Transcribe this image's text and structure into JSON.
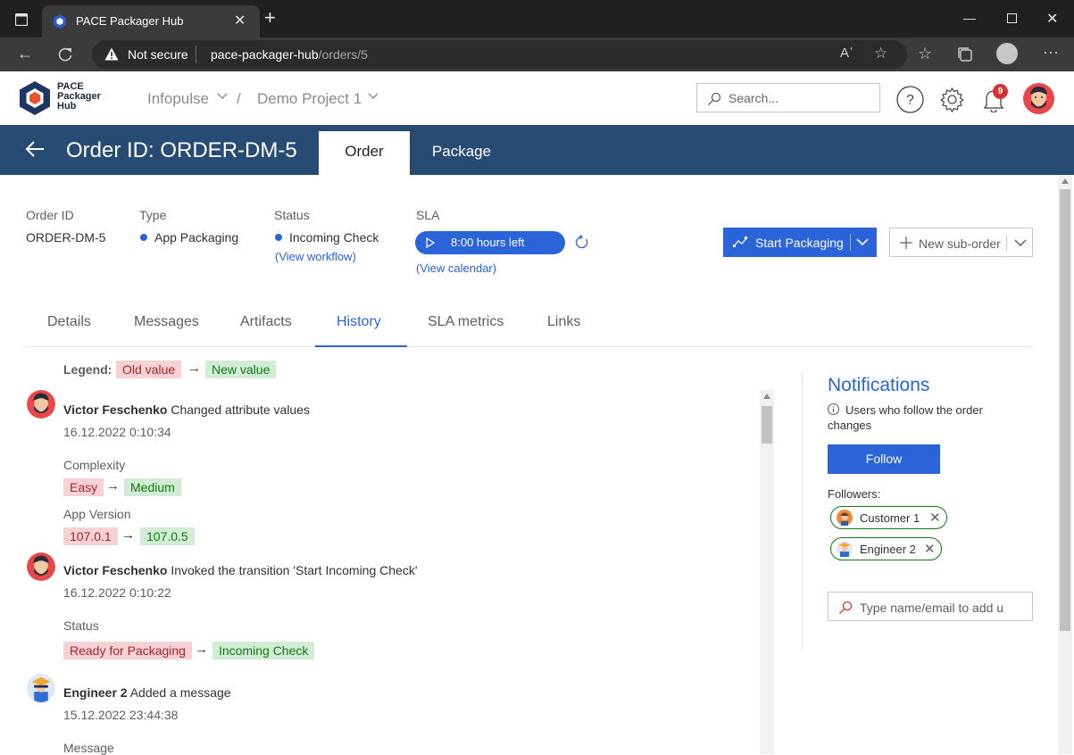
{
  "browser": {
    "tab_title": "PACE Packager Hub",
    "security_label": "Not secure",
    "url_host": "pace-packager-hub",
    "url_path": "/orders/5"
  },
  "header": {
    "logo_lines": [
      "PACE",
      "Packager",
      "Hub"
    ],
    "breadcrumb_org": "Infopulse",
    "breadcrumb_sep": "/",
    "breadcrumb_project": "Demo Project 1",
    "search_placeholder": "Search...",
    "notification_count": "9"
  },
  "order_bar": {
    "title": "Order ID: ORDER-DM-5",
    "tabs": [
      "Order",
      "Package"
    ],
    "active_tab": "Order"
  },
  "info": {
    "order_id_label": "Order ID",
    "order_id_value": "ORDER-DM-5",
    "type_label": "Type",
    "type_value": "App Packaging",
    "status_label": "Status",
    "status_value": "Incoming Check",
    "view_workflow": "(View workflow)",
    "sla_label": "SLA",
    "sla_value": "8:00 hours left",
    "view_calendar": "(View calendar)",
    "start_packaging": "Start Packaging",
    "new_suborder": "New sub-order"
  },
  "subtabs": [
    "Details",
    "Messages",
    "Artifacts",
    "History",
    "SLA metrics",
    "Links"
  ],
  "active_subtab": "History",
  "legend": {
    "label": "Legend:",
    "old": "Old value",
    "new": "New value"
  },
  "history": [
    {
      "user": "Victor Feschenko",
      "action": "Changed attribute values",
      "date": "16.12.2022 0:10:34",
      "changes": [
        {
          "field": "Complexity",
          "old": "Easy",
          "new": "Medium"
        },
        {
          "field": "App Version",
          "old": "107.0.1",
          "new": "107.0.5"
        }
      ]
    },
    {
      "user": "Victor Feschenko",
      "action": "Invoked the transition 'Start Incoming Check'",
      "date": "16.12.2022 0:10:22",
      "changes": [
        {
          "field": "Status",
          "old": "Ready for Packaging",
          "new": "Incoming Check"
        }
      ]
    },
    {
      "user": "Engineer 2",
      "action": "Added a message",
      "date": "15.12.2022 23:44:38",
      "changes": [
        {
          "field": "Message"
        }
      ]
    }
  ],
  "notifications": {
    "title": "Notifications",
    "description": "Users who follow the order changes",
    "follow_button": "Follow",
    "followers_label": "Followers:",
    "followers": [
      "Customer 1",
      "Engineer 2"
    ],
    "add_placeholder": "Type name/email to add u"
  },
  "colors": {
    "header_bar": "#274b72",
    "accent": "#2b63d9",
    "old_bg": "#f7d2d4",
    "new_bg": "#d3ecd5"
  }
}
